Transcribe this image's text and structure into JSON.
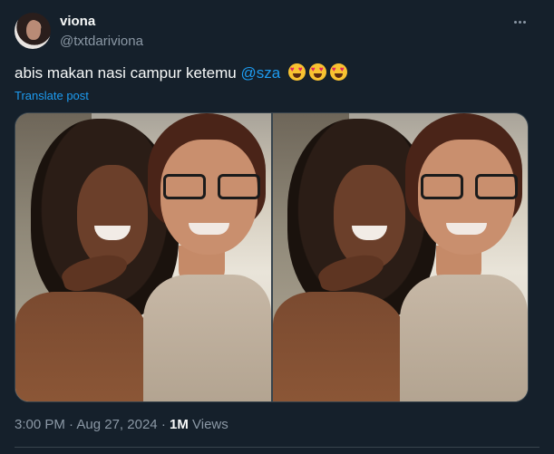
{
  "post": {
    "display_name": "viona",
    "handle": "@txtdariviona",
    "text_before": "abis makan nasi campur ketemu ",
    "mention": "@sza",
    "emojis": [
      "heart-eyes-emoji",
      "heart-eyes-emoji",
      "heart-eyes-emoji"
    ],
    "translate_label": "Translate post",
    "time": "3:00 PM",
    "date": "Aug 27, 2024",
    "views_count": "1M",
    "views_label": "Views",
    "separator": "·"
  },
  "media": {
    "photos": [
      "photo-1",
      "photo-2"
    ]
  },
  "colors": {
    "background": "#15202b",
    "accent": "#1d9bf0",
    "secondary_text": "#8b98a5"
  },
  "icons": {
    "more": "more-horizontal-icon"
  }
}
